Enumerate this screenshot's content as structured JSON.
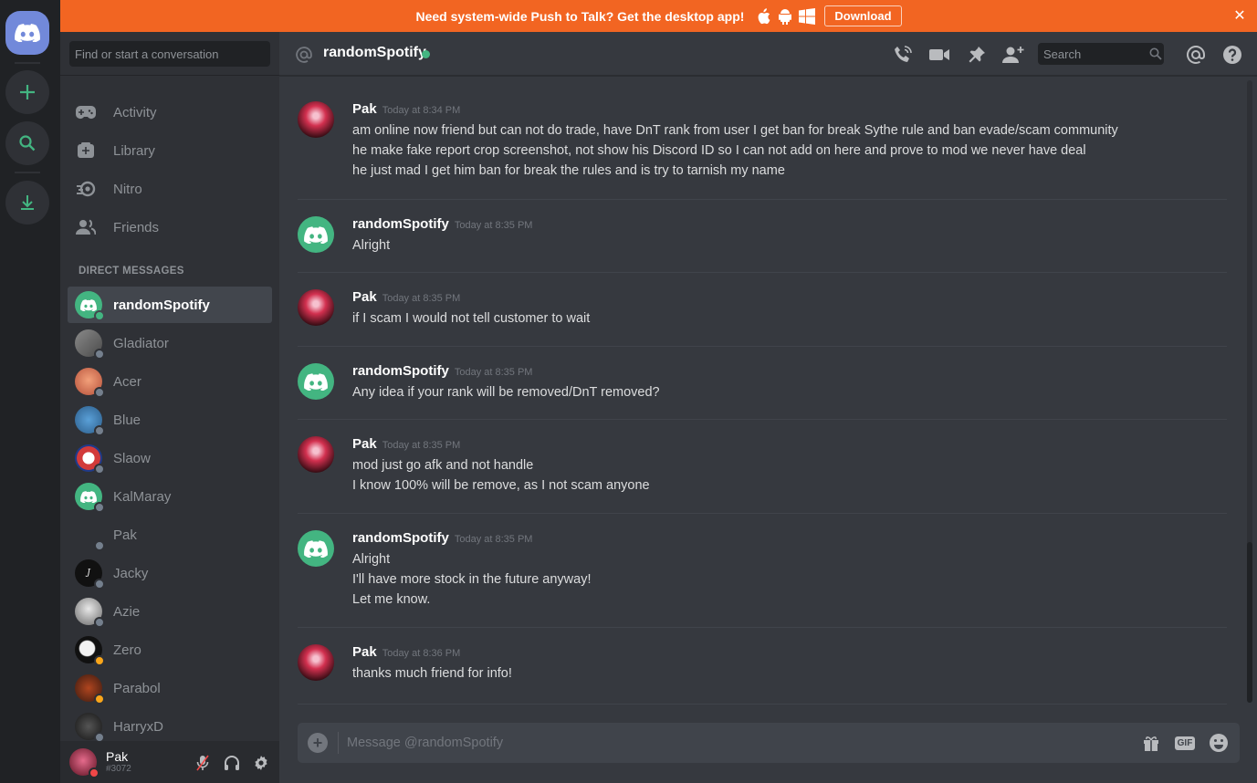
{
  "banner": {
    "text": "Need system-wide Push to Talk? Get the desktop app!",
    "download_label": "Download",
    "os_icons": [
      "apple-icon",
      "android-icon",
      "windows-icon"
    ],
    "close_icon": "close-icon",
    "color": "#f26522"
  },
  "guild_rail": {
    "items": [
      "discord-home-icon",
      "add-server-icon",
      "explore-search-icon",
      "download-apps-icon"
    ]
  },
  "dm_sidebar": {
    "search_placeholder": "Find or start a conversation",
    "nav": [
      {
        "label": "Activity",
        "icon": "gamepad-icon"
      },
      {
        "label": "Library",
        "icon": "library-icon"
      },
      {
        "label": "Nitro",
        "icon": "nitro-icon"
      },
      {
        "label": "Friends",
        "icon": "friends-icon"
      }
    ],
    "section_title": "DIRECT MESSAGES",
    "dms": [
      {
        "name": "randomSpotify",
        "status": "online"
      },
      {
        "name": "Gladiator",
        "status": "offline"
      },
      {
        "name": "Acer",
        "status": "offline"
      },
      {
        "name": "Blue",
        "status": "offline"
      },
      {
        "name": "Slaow",
        "status": "offline"
      },
      {
        "name": "KalMaray",
        "status": "offline"
      },
      {
        "name": "Pak",
        "status": "offline"
      },
      {
        "name": "Jacky",
        "status": "offline"
      },
      {
        "name": "Azie",
        "status": "offline"
      },
      {
        "name": "Zero",
        "status": "idle"
      },
      {
        "name": "Parabol",
        "status": "idle"
      },
      {
        "name": "HarryxD",
        "status": "offline"
      }
    ]
  },
  "user_panel": {
    "name": "Pak",
    "tag": "#3072",
    "icons": [
      "mute-mic-icon",
      "headphones-icon",
      "settings-gear-icon"
    ]
  },
  "chat_header": {
    "title": "randomSpotify",
    "search_placeholder": "Search",
    "tools": [
      "voice-call-icon",
      "video-call-icon",
      "pin-icon",
      "add-friend-icon",
      "mentions-icon",
      "help-icon"
    ]
  },
  "messages": [
    {
      "author": "Pak",
      "time": "Today at 8:34 PM",
      "lines": [
        "am online now friend but can not do trade, have DnT rank from user I get ban for break Sythe rule and ban evade/scam community",
        "he make fake report crop screenshot, not show his Discord ID so I can not add on here and prove to mod we never have deal",
        "he just mad I get him ban for break the rules and is try to tarnish my name"
      ]
    },
    {
      "author": "randomSpotify",
      "time": "Today at 8:35 PM",
      "lines": [
        "Alright"
      ]
    },
    {
      "author": "Pak",
      "time": "Today at 8:35 PM",
      "lines": [
        "if I scam I would not tell customer to wait"
      ]
    },
    {
      "author": "randomSpotify",
      "time": "Today at 8:35 PM",
      "lines": [
        "Any idea if your rank will be removed/DnT removed?"
      ]
    },
    {
      "author": "Pak",
      "time": "Today at 8:35 PM",
      "lines": [
        "mod just go afk and not handle",
        "I know 100% will be remove, as I not scam anyone"
      ]
    },
    {
      "author": "randomSpotify",
      "time": "Today at 8:35 PM",
      "lines": [
        "Alright",
        "I'll have more stock in the future anyway!",
        "Let me know."
      ]
    },
    {
      "author": "Pak",
      "time": "Today at 8:36 PM",
      "lines": [
        "thanks much friend for info!"
      ]
    }
  ],
  "composer": {
    "placeholder": "Message @randomSpotify",
    "gif_label": "GIF",
    "icons": [
      "add-attachment-icon",
      "gift-icon",
      "gif-icon",
      "emoji-icon"
    ]
  },
  "colors": {
    "status_online": "#43b581",
    "status_idle": "#faa61a",
    "status_offline": "#747f8d",
    "status_dnd": "#f04747",
    "blurple": "#7289da"
  }
}
